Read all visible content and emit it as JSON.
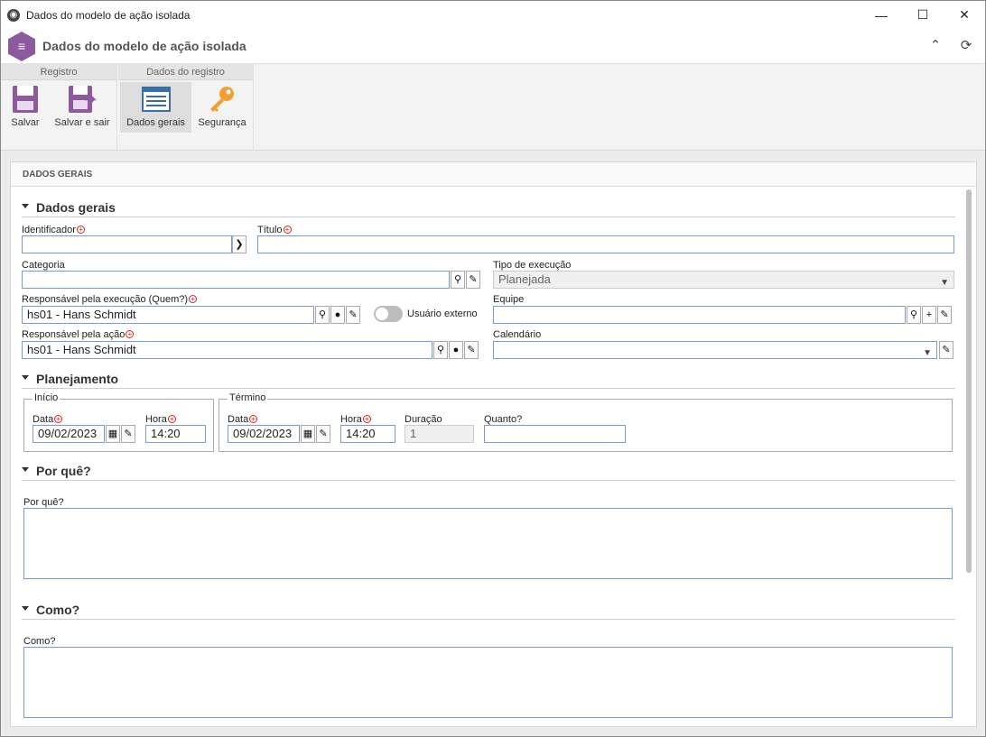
{
  "window": {
    "title": "Dados do modelo de ação isolada",
    "minimize": "—",
    "maximize": "☐",
    "close": "✕"
  },
  "header": {
    "title": "Dados do modelo de ação isolada"
  },
  "ribbon": {
    "group1": "Registro",
    "group2": "Dados do registro",
    "save": "Salvar",
    "save_exit": "Salvar e sair",
    "general": "Dados gerais",
    "security": "Segurança"
  },
  "panel": {
    "title": "DADOS GERAIS"
  },
  "sections": {
    "general": "Dados gerais",
    "planning": "Planejamento",
    "why": "Por quê?",
    "how": "Como?"
  },
  "fields": {
    "identifier": {
      "label": "Identificador",
      "value": ""
    },
    "title": {
      "label": "Título",
      "value": ""
    },
    "category": {
      "label": "Categoria",
      "value": ""
    },
    "execution_type": {
      "label": "Tipo de execução",
      "value": "Planejada"
    },
    "responsible_exec": {
      "label": "Responsável pela execução (Quem?)",
      "value": "hs01 - Hans Schmidt"
    },
    "external_user": {
      "label": "Usuário externo",
      "on": false
    },
    "team": {
      "label": "Equipe",
      "value": ""
    },
    "responsible_action": {
      "label": "Responsável pela ação",
      "value": "hs01 - Hans Schmidt"
    },
    "calendar": {
      "label": "Calendário",
      "value": ""
    }
  },
  "planning": {
    "start": {
      "legend": "Início",
      "date_label": "Data",
      "date": "09/02/2023",
      "time_label": "Hora",
      "time": "14:20"
    },
    "end": {
      "legend": "Término",
      "date_label": "Data",
      "date": "09/02/2023",
      "time_label": "Hora",
      "time": "14:20",
      "duration_label": "Duração",
      "duration": "1",
      "amount_label": "Quanto?",
      "amount": ""
    }
  },
  "why": {
    "label": "Por quê?",
    "value": ""
  },
  "how": {
    "label": "Como?",
    "value": ""
  },
  "colors": {
    "accent": "#8e5a9e",
    "border": "#7a9cc6",
    "required": "#dd2222"
  }
}
